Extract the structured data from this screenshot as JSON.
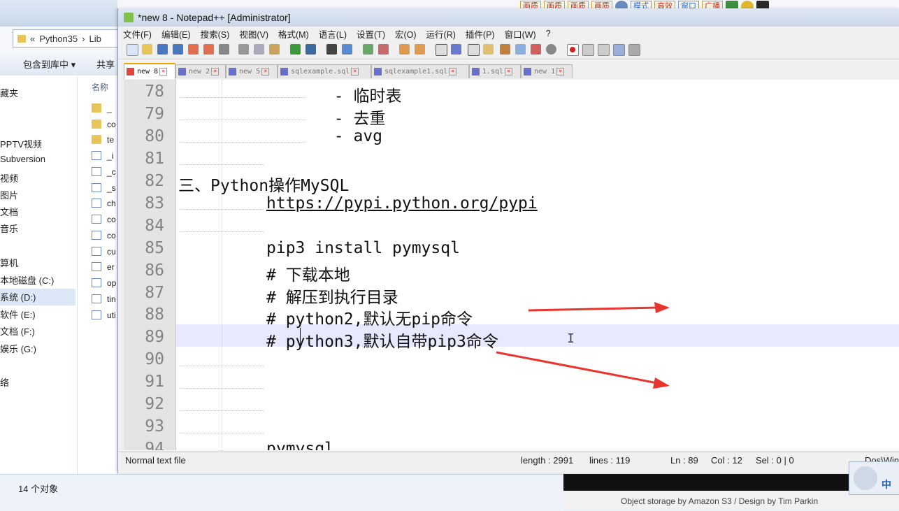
{
  "explorer": {
    "address_seg1": "«",
    "address_seg2": "Python35",
    "address_seg3": "Lib",
    "toolbar_include": "包含到库中 ▾",
    "toolbar_share": "共享",
    "files_header": "名称",
    "nav_items": [
      "藏夹",
      "PPTV视频",
      "Subversion",
      "视频",
      "图片",
      "文档",
      "音乐",
      "算机",
      "本地磁盘 (C:)",
      "系统 (D:)",
      "软件 (E:)",
      "文档 (F:)",
      "娱乐 (G:)",
      "络"
    ],
    "files": [
      "_",
      "co",
      "te",
      "_i",
      "_c",
      "_s",
      "ch",
      "co",
      "co",
      "cu",
      "er",
      "op",
      "tin",
      "uti"
    ],
    "status": "14 个对象"
  },
  "tray": {
    "buttons": [
      "画质",
      "画质",
      "画质",
      "画质"
    ],
    "buttons2": [
      "模式",
      "高效",
      "窗口",
      "广播"
    ]
  },
  "npp": {
    "title": "*new 8 - Notepad++ [Administrator]",
    "menu": [
      "文件(F)",
      "编辑(E)",
      "搜索(S)",
      "视图(V)",
      "格式(M)",
      "语言(L)",
      "设置(T)",
      "宏(O)",
      "运行(R)",
      "插件(P)",
      "窗口(W)",
      "?"
    ],
    "tabs": [
      "new 8",
      "new 2",
      "new 5",
      "sqlexample.sql",
      "sqlexample1.sql",
      "1.sql",
      "new 1"
    ],
    "lines": [
      {
        "num": "78",
        "text": "        - 临时表"
      },
      {
        "num": "79",
        "text": "        - 去重"
      },
      {
        "num": "80",
        "text": "        - avg"
      },
      {
        "num": "81",
        "text": ""
      },
      {
        "num": "82",
        "text": "三、Python操作MySQL"
      },
      {
        "num": "83",
        "text": "https://pypi.python.org/pypi"
      },
      {
        "num": "84",
        "text": ""
      },
      {
        "num": "85",
        "text": "pip3 install pymysql"
      },
      {
        "num": "86",
        "text": "# 下载本地"
      },
      {
        "num": "87",
        "text": "# 解压到执行目录"
      },
      {
        "num": "88",
        "text": "# python2,默认无pip命令"
      },
      {
        "num": "89",
        "text": "# python3,默认自带pip3命令"
      },
      {
        "num": "90",
        "text": ""
      },
      {
        "num": "91",
        "text": ""
      },
      {
        "num": "92",
        "text": ""
      },
      {
        "num": "93",
        "text": ""
      },
      {
        "num": "94",
        "text": "pymysql"
      }
    ],
    "status": {
      "filetype": "Normal text file",
      "length": "length : 2991",
      "lines": "lines : 119",
      "ln": "Ln : 89",
      "col": "Col : 12",
      "sel": "Sel : 0 | 0",
      "eol": "Dos\\Win"
    }
  },
  "web": {
    "caption": "Object storage by Amazon S3 / Design by Tim Parkin"
  },
  "ime": {
    "lang": "中"
  },
  "colors": {
    "arrow": "#e8352e",
    "current_line": "#e8e8ff",
    "tab_accent": "#f0a500"
  }
}
